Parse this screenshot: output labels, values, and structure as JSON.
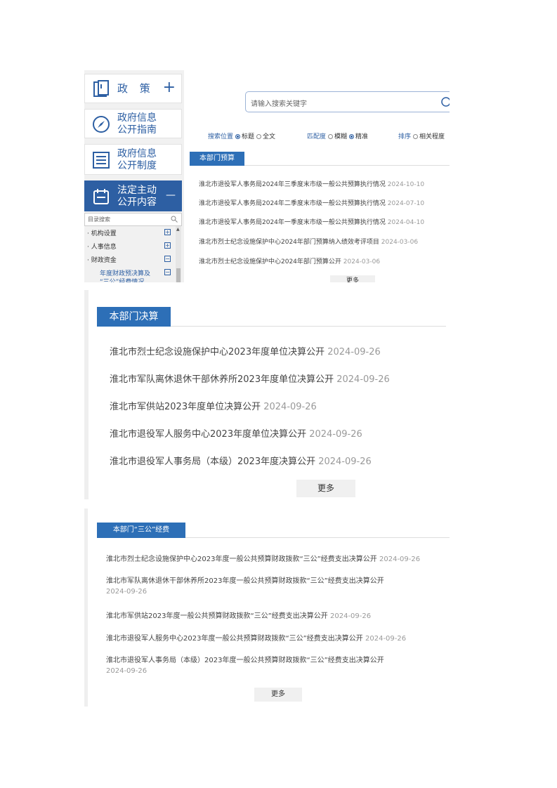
{
  "sidebar": {
    "nav": [
      {
        "label": "政 策",
        "suffix": "+"
      },
      {
        "label": "政府信息\n公开指南"
      },
      {
        "label": "政府信息\n公开制度"
      },
      {
        "label": "法定主动\n公开内容",
        "suffix": "—"
      }
    ],
    "dir_search_placeholder": "目录搜索",
    "tree": [
      {
        "label": "· 机构设置",
        "toggle": "+"
      },
      {
        "label": "· 人事信息",
        "toggle": "+"
      },
      {
        "label": "· 财政资金",
        "toggle": "−"
      },
      {
        "label": "年度财政预决算及",
        "toggle": "−"
      },
      {
        "label": "“三公”经费情况"
      }
    ]
  },
  "search": {
    "placeholder": "请输入搜索关键字",
    "position_label": "搜索位置",
    "position_opts": [
      "标题",
      "全文"
    ],
    "match_label": "匹配度",
    "match_opts": [
      "模糊",
      "精准"
    ],
    "sort_label": "排序",
    "sort_opts": [
      "相关程度"
    ]
  },
  "budget": {
    "tab": "本部门预算",
    "items": [
      {
        "title": "淮北市退役军人事务局2024年三季度末市级一般公共预算执行情况",
        "date": "2024-10-10"
      },
      {
        "title": "淮北市退役军人事务局2024年二季度末市级一般公共预算执行情况",
        "date": "2024-07-10"
      },
      {
        "title": "淮北市退役军人事务局2024年一季度末市级一般公共预算执行情况",
        "date": "2024-04-10"
      },
      {
        "title": "淮北市烈士纪念设施保护中心2024年部门预算纳入绩效考评项目",
        "date": "2024-03-06"
      },
      {
        "title": "淮北市烈士纪念设施保护中心2024年部门预算公开",
        "date": "2024-03-06"
      }
    ],
    "more": "更多"
  },
  "final_accounts": {
    "tab": "本部门决算",
    "items": [
      {
        "title": "淮北市烈士纪念设施保护中心2023年度单位决算公开",
        "date": "2024-09-26"
      },
      {
        "title": "淮北市军队离休退休干部休养所2023年度单位决算公开",
        "date": "2024-09-26"
      },
      {
        "title": "淮北市军供站2023年度单位决算公开",
        "date": "2024-09-26"
      },
      {
        "title": "淮北市退役军人服务中心2023年度单位决算公开",
        "date": "2024-09-26"
      },
      {
        "title": "淮北市退役军人事务局（本级）2023年度决算公开",
        "date": "2024-09-26"
      }
    ],
    "more": "更多"
  },
  "three_public": {
    "tab": "本部门“三公”经费",
    "items": [
      {
        "title": "淮北市烈士纪念设施保护中心2023年度一般公共预算财政拨款“三公”经费支出决算公开",
        "date": "2024-09-26"
      },
      {
        "title": "淮北市军队离休退休干部休养所2023年度一般公共预算财政拨款“三公”经费支出决算公开",
        "date": "2024-09-26"
      },
      {
        "title": "淮北市军供站2023年度一般公共预算财政拨款“三公”经费支出决算公开",
        "date": "2024-09-26"
      },
      {
        "title": "淮北市退役军人服务中心2023年度一般公共预算财政拨款“三公”经费支出决算公开",
        "date": "2024-09-26"
      },
      {
        "title": "淮北市退役军人事务局（本级）2023年度一般公共预算财政拨款“三公”经费支出决算公开",
        "date": "2024-09-26"
      }
    ],
    "more": "更多"
  }
}
